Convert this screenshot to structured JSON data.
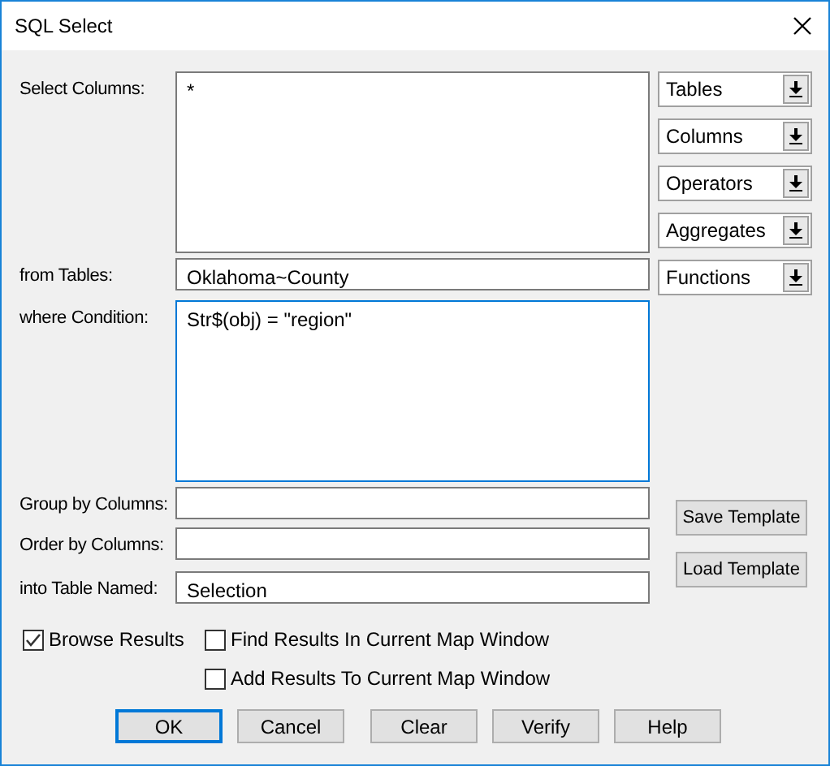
{
  "window": {
    "title": "SQL Select"
  },
  "fields": [
    {
      "label": "Select Columns:",
      "kind": "multiline",
      "value": "*",
      "focused": false
    },
    {
      "label": "from Tables:",
      "kind": "line",
      "value": "Oklahoma~County",
      "focused": false
    },
    {
      "label": "where Condition:",
      "kind": "multiline",
      "value": "Str$(obj) = \"region\"",
      "focused": true
    },
    {
      "label": "Group by Columns:",
      "kind": "line",
      "focused": false
    },
    {
      "label": "Order by Columns:",
      "kind": "line",
      "focused": false
    },
    {
      "label": "into Table Named:",
      "kind": "line",
      "value": "Selection",
      "focused": false
    }
  ],
  "dropdowns": [
    "Tables",
    "Columns",
    "Operators",
    "Aggregates",
    "Functions"
  ],
  "template_buttons": [
    "Save Template",
    "Load Template"
  ],
  "options": [
    {
      "label": "Browse Results",
      "checked": true
    },
    {
      "label": "Find Results In Current Map Window",
      "checked": false
    },
    {
      "label": "Add Results To Current Map Window",
      "checked": false
    }
  ],
  "buttons": [
    {
      "label": "OK",
      "default": true
    },
    {
      "label": "Cancel",
      "default": false
    },
    {
      "label": "Clear",
      "default": false
    },
    {
      "label": "Verify",
      "default": false
    },
    {
      "label": "Help",
      "default": false
    }
  ]
}
